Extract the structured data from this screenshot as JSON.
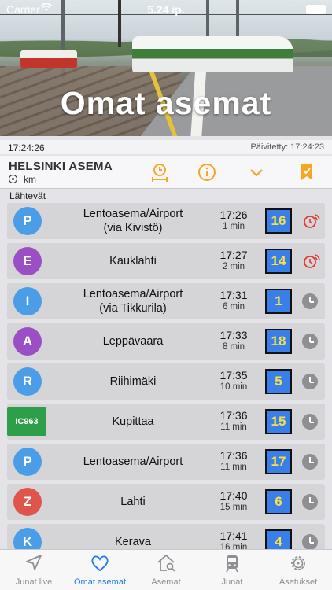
{
  "status_bar": {
    "carrier": "Carrier",
    "time": "5.24 ip."
  },
  "hero": {
    "title": "Omat asemat"
  },
  "info": {
    "clock": "17:24:26",
    "updated": "Päivitetty: 17:24:23"
  },
  "station": {
    "name": "HELSINKI ASEMA",
    "distance": "km"
  },
  "section_label": "Lähtevät",
  "colors": {
    "accent": "#f5a623",
    "active_tab": "#1f7af0",
    "track_bg": "#3a7ee8",
    "track_text": "#f4e04a",
    "alarm": "#e23a33"
  },
  "departures": [
    {
      "line": "P",
      "line_color": "#4a9de6",
      "dest": "Lentoasema/Airport",
      "via": "(via Kivistö)",
      "time": "17:26",
      "mins": "1 min",
      "track": "16",
      "alarm": true
    },
    {
      "line": "E",
      "line_color": "#9b4fc4",
      "dest": "Kauklahti",
      "via": "",
      "time": "17:27",
      "mins": "2 min",
      "track": "14",
      "alarm": true
    },
    {
      "line": "I",
      "line_color": "#4a9de6",
      "dest": "Lentoasema/Airport",
      "via": "(via Tikkurila)",
      "time": "17:31",
      "mins": "6 min",
      "track": "1",
      "alarm": false
    },
    {
      "line": "A",
      "line_color": "#9b4fc4",
      "dest": "Leppävaara",
      "via": "",
      "time": "17:33",
      "mins": "8 min",
      "track": "18",
      "alarm": false
    },
    {
      "line": "R",
      "line_color": "#4a9de6",
      "dest": "Riihimäki",
      "via": "",
      "time": "17:35",
      "mins": "10 min",
      "track": "5",
      "alarm": false
    },
    {
      "line": "IC963",
      "line_color": "#2f9e4a",
      "dest": "Kupittaa",
      "via": "",
      "time": "17:36",
      "mins": "11 min",
      "track": "15",
      "alarm": false,
      "intercity": true
    },
    {
      "line": "P",
      "line_color": "#4a9de6",
      "dest": "Lentoasema/Airport",
      "via": "",
      "time": "17:36",
      "mins": "11 min",
      "track": "17",
      "alarm": false
    },
    {
      "line": "Z",
      "line_color": "#e0554b",
      "dest": "Lahti",
      "via": "",
      "time": "17:40",
      "mins": "15 min",
      "track": "6",
      "alarm": false
    },
    {
      "line": "K",
      "line_color": "#4a9de6",
      "dest": "Kerava",
      "via": "",
      "time": "17:41",
      "mins": "16 min",
      "track": "4",
      "alarm": false
    }
  ],
  "tabs": [
    {
      "label": "Junat live",
      "icon": "location-arrow-icon",
      "active": false
    },
    {
      "label": "Omat asemat",
      "icon": "heart-icon",
      "active": true
    },
    {
      "label": "Asemat",
      "icon": "station-search-icon",
      "active": false
    },
    {
      "label": "Junat",
      "icon": "train-icon",
      "active": false
    },
    {
      "label": "Asetukset",
      "icon": "gear-icon",
      "active": false
    }
  ]
}
